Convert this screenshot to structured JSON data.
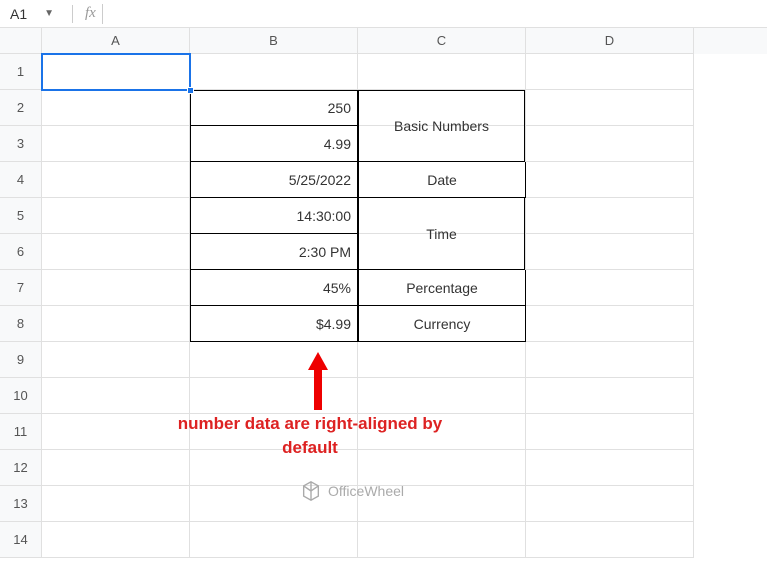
{
  "nameBox": {
    "value": "A1"
  },
  "formulaBar": {
    "label": "fx",
    "value": ""
  },
  "columns": [
    "A",
    "B",
    "C",
    "D"
  ],
  "rows": [
    "1",
    "2",
    "3",
    "4",
    "5",
    "6",
    "7",
    "8",
    "9",
    "10",
    "11",
    "12",
    "13",
    "14"
  ],
  "table": {
    "b2": "250",
    "b3": "4.99",
    "b4": "5/25/2022",
    "b5": "14:30:00",
    "b6": "2:30 PM",
    "b7": "45%",
    "b8": "$4.99",
    "c_basic": "Basic Numbers",
    "c_date": "Date",
    "c_time": "Time",
    "c_percentage": "Percentage",
    "c_currency": "Currency"
  },
  "annotation": "number data are right-aligned by default",
  "watermark": "OfficeWheel"
}
